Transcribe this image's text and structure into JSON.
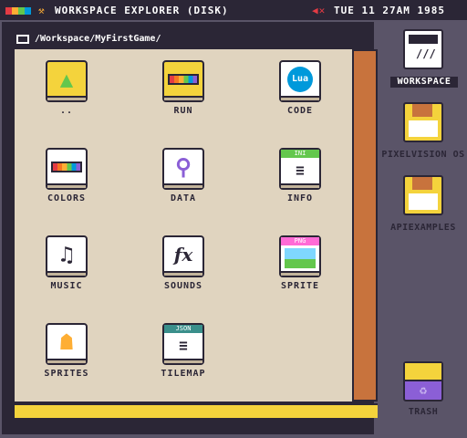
{
  "topbar": {
    "title": "WORKSPACE EXPLORER (DISK)",
    "datetime": "TUE 11 27AM 1985",
    "mute_icon": "speaker-muted-icon"
  },
  "path": "/Workspace/MyFirstGame/",
  "items": [
    {
      "label": "..",
      "icon": "up-folder-icon"
    },
    {
      "label": "RUN",
      "icon": "run-icon"
    },
    {
      "label": "CODE",
      "icon": "lua-icon",
      "badge": "Lua"
    },
    {
      "label": "COLORS",
      "icon": "colors-icon"
    },
    {
      "label": "DATA",
      "icon": "wrench-icon"
    },
    {
      "label": "INFO",
      "icon": "ini-file-icon",
      "badge": "INI"
    },
    {
      "label": "MUSIC",
      "icon": "music-note-icon"
    },
    {
      "label": "SOUNDS",
      "icon": "fx-icon"
    },
    {
      "label": "SPRITE",
      "icon": "png-file-icon",
      "badge": "PNG"
    },
    {
      "label": "SPRITES",
      "icon": "sprite-icon"
    },
    {
      "label": "TILEMAP",
      "icon": "json-file-icon",
      "badge": "JSON"
    }
  ],
  "sidebar": [
    {
      "label": "WORKSPACE",
      "icon": "computer-icon"
    },
    {
      "label": "PIXELVISION OS",
      "icon": "disk-icon"
    },
    {
      "label": "APIEXAMPLES",
      "icon": "disk-icon"
    },
    {
      "label": "TRASH",
      "icon": "trash-icon"
    }
  ],
  "colors": {
    "accent_yellow": "#f4d33c",
    "scrollbar": "#c8733d",
    "bg_dark": "#2b2636"
  }
}
